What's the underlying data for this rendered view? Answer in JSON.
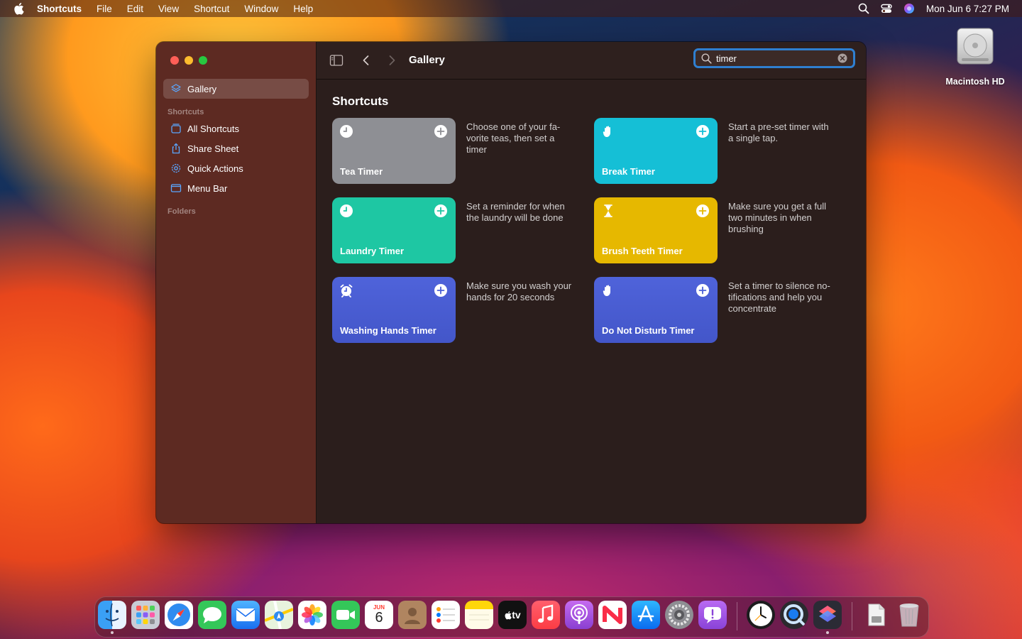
{
  "menubar": {
    "app_name": "Shortcuts",
    "items": [
      "File",
      "Edit",
      "View",
      "Shortcut",
      "Window",
      "Help"
    ],
    "clock": "Mon Jun 6  7:27 PM"
  },
  "desktop": {
    "drive_label": "Macintosh HD"
  },
  "sidebar": {
    "gallery_label": "Gallery",
    "shortcuts_section": "Shortcuts",
    "items": [
      {
        "label": "All Shortcuts",
        "icon": "all-shortcuts-icon"
      },
      {
        "label": "Share Sheet",
        "icon": "share-sheet-icon"
      },
      {
        "label": "Quick Actions",
        "icon": "gear-icon"
      },
      {
        "label": "Menu Bar",
        "icon": "menu-bar-icon"
      }
    ],
    "folders_section": "Folders"
  },
  "toolbar": {
    "title": "Gallery",
    "search_value": "timer"
  },
  "content": {
    "section_title": "Shortcuts",
    "cards": [
      {
        "name": "Tea Timer",
        "icon": "clock-icon",
        "color": "#8e8f94",
        "description": "Choose one of your fa-\nvorite teas, then set a\ntimer"
      },
      {
        "name": "Break Timer",
        "icon": "hand-icon",
        "color": "#15bfd6",
        "description": "Start a pre-set timer with\na single tap."
      },
      {
        "name": "Laundry Timer",
        "icon": "clock-icon",
        "color": "#1ec7a3",
        "description": "Set a reminder for when\nthe laundry will be done"
      },
      {
        "name": "Brush Teeth Timer",
        "icon": "hourglass-icon",
        "color": "#e6b800",
        "description": "Make sure you get a full\ntwo minutes in when\nbrushing"
      },
      {
        "name": "Washing Hands Timer",
        "icon": "alarm-icon",
        "color": "#4a5fd6",
        "description": "Make sure you wash your\nhands for 20 seconds"
      },
      {
        "name": "Do Not Disturb Timer",
        "icon": "hand-icon",
        "color": "#4a5fd6",
        "description": "Set a timer to silence no-\ntifications and help you\nconcentrate"
      }
    ]
  },
  "dock": {
    "apps": [
      "Finder",
      "Launchpad",
      "Safari",
      "Messages",
      "Mail",
      "Maps",
      "Photos",
      "FaceTime",
      "Calendar",
      "Contacts",
      "Reminders",
      "Notes",
      "TV",
      "Music",
      "Podcasts",
      "News",
      "App Store",
      "System Preferences",
      "Feedback Assistant",
      "Clock",
      "QuickTime Player",
      "Shortcuts",
      "Downloads",
      "Trash"
    ],
    "calendar_month": "JUN",
    "calendar_day": "6",
    "tv_label": "tv"
  }
}
